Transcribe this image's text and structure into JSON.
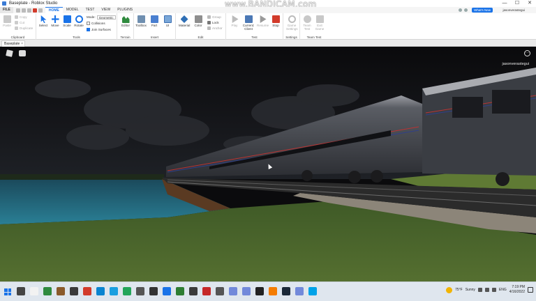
{
  "window": {
    "title": "Baseplate - Roblox Studio",
    "controls": {
      "minimize": "—",
      "maximize": "☐",
      "close": "✕"
    }
  },
  "watermark": "www.BANDICAM.com",
  "menubar": {
    "file": "FILE",
    "tabs": [
      "HOME",
      "MODEL",
      "TEST",
      "VIEW",
      "PLUGINS"
    ],
    "active_tab": "HOME",
    "whats_new": "What's New",
    "username": "jasonverastegui"
  },
  "ribbon": {
    "clipboard": {
      "paste": "Paste",
      "copy": "Copy",
      "cut": "Cut",
      "duplicate": "Duplicate",
      "group_name": "Clipboard"
    },
    "tools": {
      "select": "Select",
      "move": "Move",
      "scale": "Scale",
      "rotate": "Rotate",
      "mode_label": "Mode:",
      "mode_value": "Geometric",
      "collisions": "Collisions",
      "join_surfaces": "Join Surfaces",
      "group_name": "Tools"
    },
    "terrain": {
      "editor": "Editor",
      "group_name": "Terrain"
    },
    "insert": {
      "toolbox": "Toolbox",
      "part": "Part",
      "ui": "UI",
      "group_name": "Insert"
    },
    "edit": {
      "material": "Material",
      "color": "Color",
      "group": "Group",
      "lock": "Lock",
      "anchor": "Anchor",
      "group_name": "Edit"
    },
    "test": {
      "play": "Play",
      "current_client": "Current: Client",
      "resume": "Resume",
      "stop": "Stop",
      "group_name": "Test"
    },
    "settings": {
      "game_settings": "Game Settings",
      "group_name": "Settings"
    },
    "team_test": {
      "team_test": "Team Test",
      "exit_game": "Exit Game",
      "group_name": "Team Test"
    }
  },
  "document_tab": {
    "label": "Baseplate",
    "close": "×"
  },
  "viewport": {
    "player_name": "jasonverastegui",
    "menu_glyph": "···"
  },
  "taskbar": {
    "weather_temp": "75°F",
    "weather_desc": "Sunny",
    "language": "ENG",
    "time": "7:19 PM",
    "date": "4/16/2022",
    "icon_colors": [
      "#444444",
      "#f2f2f2",
      "#2f8a3e",
      "#8a5a2b",
      "#3a3a3a",
      "#d23b2b",
      "#0a84d0",
      "#1a9fe0",
      "#23a55a",
      "#555555",
      "#333333",
      "#1a73e8",
      "#2e7d32",
      "#3b3b3b",
      "#c62828",
      "#555555",
      "#7289da",
      "#7289da",
      "#222222",
      "#f57c00",
      "#1b2838",
      "#7289da",
      "#00a2e8"
    ]
  },
  "colors": {
    "accent": "#1a73e8",
    "sky": "#0b0b0d",
    "grass": "#4b6b2c",
    "water": "#1d5d73",
    "train": "#4a4d55"
  }
}
